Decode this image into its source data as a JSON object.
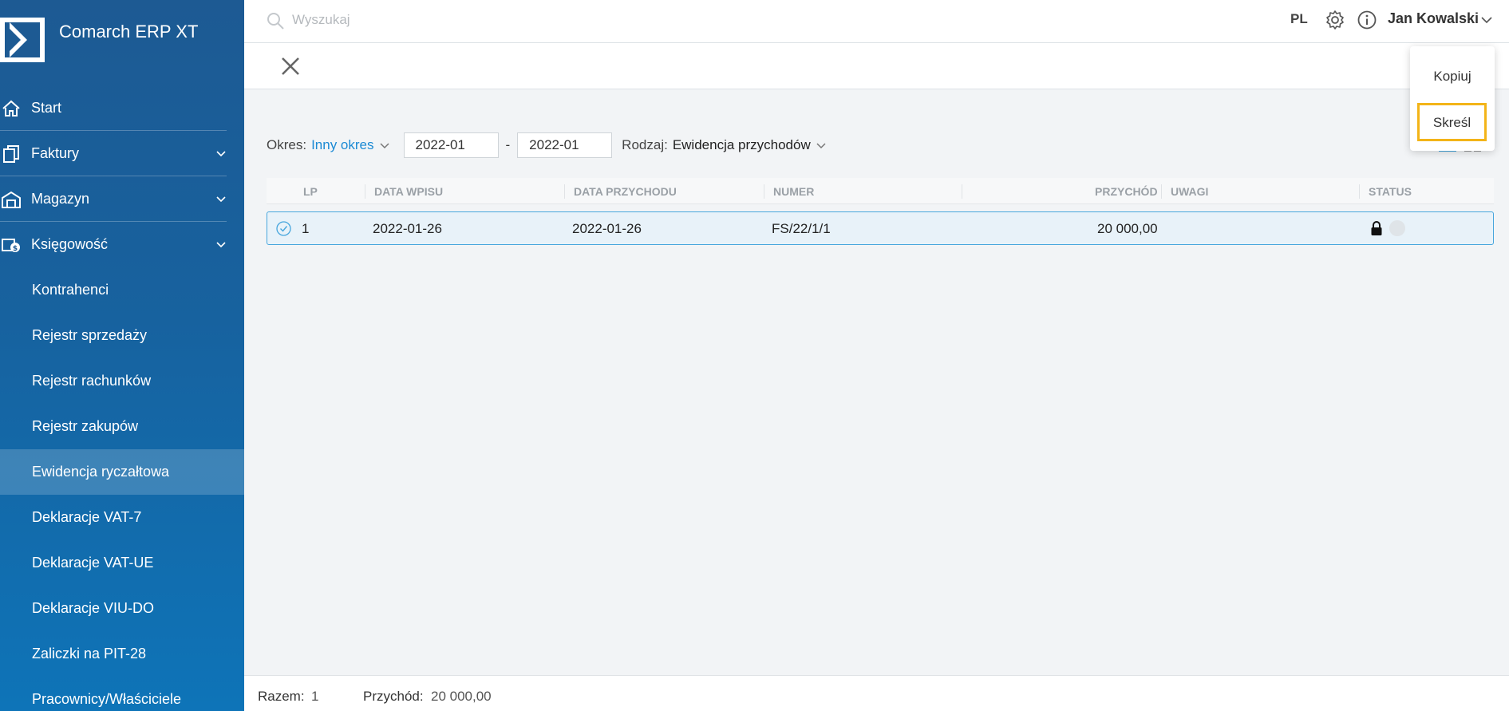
{
  "app": {
    "name": "Comarch ERP XT"
  },
  "search": {
    "placeholder": "Wyszukaj"
  },
  "header": {
    "language": "PL",
    "user_name": "Jan Kowalski"
  },
  "sidebar": {
    "items": [
      {
        "label": "Start",
        "icon": "home-icon"
      },
      {
        "label": "Faktury",
        "icon": "documents-icon"
      },
      {
        "label": "Magazyn",
        "icon": "warehouse-icon"
      },
      {
        "label": "Księgowość",
        "icon": "coins-icon"
      }
    ],
    "subitems": [
      {
        "label": "Kontrahenci"
      },
      {
        "label": "Rejestr sprzedaży"
      },
      {
        "label": "Rejestr rachunków"
      },
      {
        "label": "Rejestr zakupów"
      },
      {
        "label": "Ewidencja ryczałtowa",
        "active": true
      },
      {
        "label": "Deklaracje VAT-7"
      },
      {
        "label": "Deklaracje VAT-UE"
      },
      {
        "label": "Deklaracje VIU-DO"
      },
      {
        "label": "Zaliczki na PIT-28"
      },
      {
        "label": "Pracownicy/Właściciele"
      }
    ]
  },
  "filters": {
    "period_label": "Okres:",
    "period_value": "Inny okres",
    "date_from": "2022-01",
    "date_separator": "-",
    "date_to": "2022-01",
    "type_label": "Rodzaj:",
    "type_value": "Ewidencja przychodów"
  },
  "table": {
    "columns": [
      "LP",
      "DATA WPISU",
      "DATA PRZYCHODU",
      "NUMER",
      "PRZYCHÓD",
      "UWAGI",
      "STATUS"
    ],
    "rows": [
      {
        "lp": "1",
        "data_wpisu": "2022-01-26",
        "data_przychodu": "2022-01-26",
        "numer": "FS/22/1/1",
        "przychod": "20 000,00",
        "uwagi": "",
        "status": "locked"
      }
    ]
  },
  "context_menu": {
    "items": [
      "Kopiuj",
      "Skreśl"
    ],
    "highlighted": "Skreśl"
  },
  "footer": {
    "total_label": "Razem:",
    "total_value": "1",
    "income_label": "Przychód:",
    "income_value": "20 000,00"
  },
  "colors": {
    "sidebar": "#17629f",
    "accent": "#1c8ad4",
    "highlight": "#f3b418",
    "selected_row": "#e8f2f9"
  }
}
